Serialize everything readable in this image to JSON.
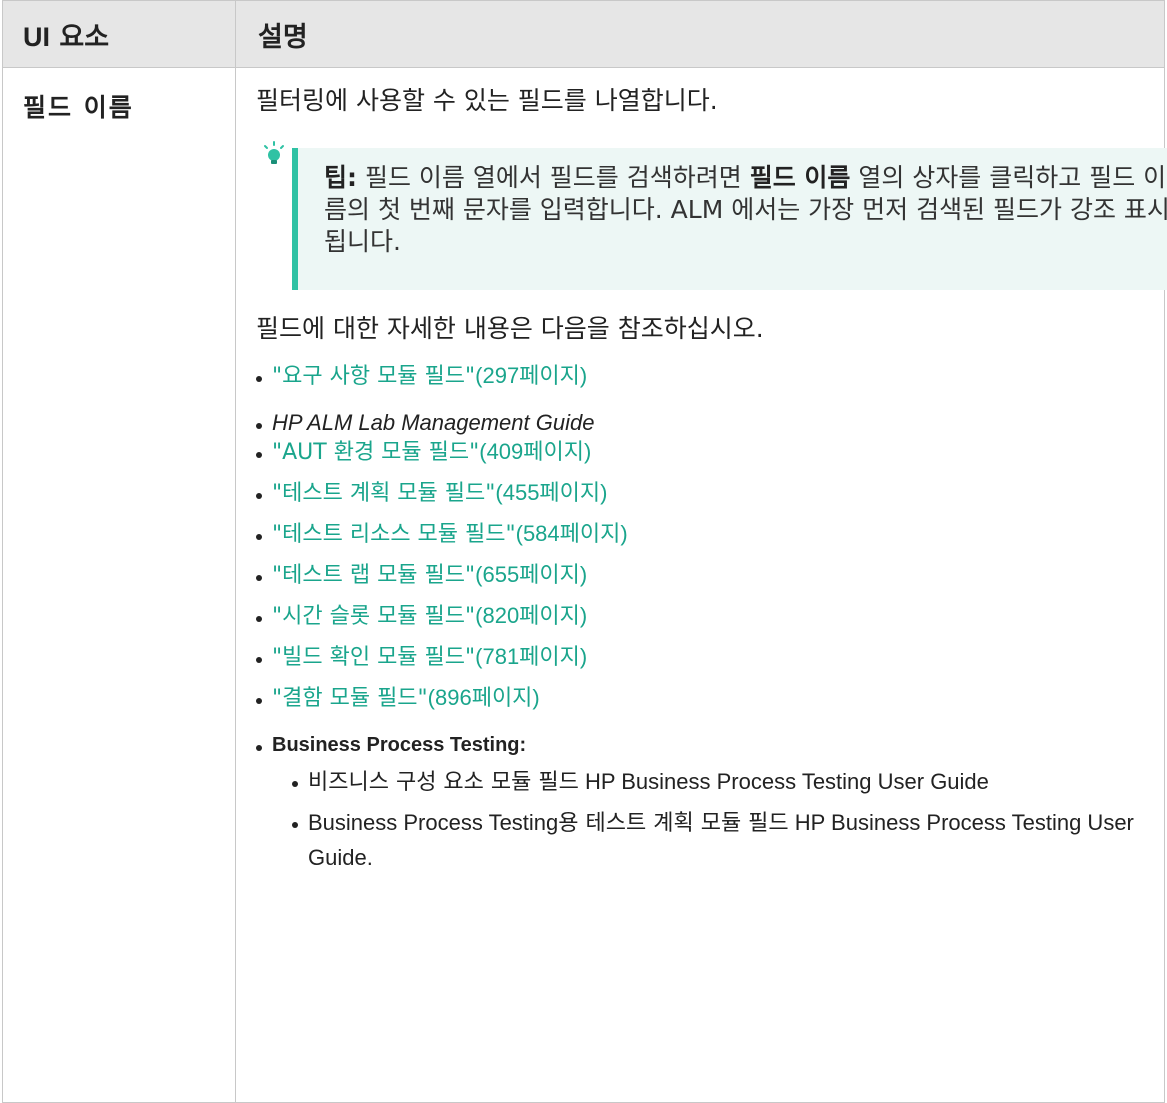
{
  "header": {
    "col1_strong": "UI",
    "col1_rest": " 요소",
    "col2": "설명"
  },
  "row": {
    "name": "필드 이름",
    "intro": "필터링에 사용할 수 있는 필드를 나열합니다.",
    "tip": {
      "label": "팁:",
      "before": " 필드 이름 열에서 필드를 검색하려면 ",
      "bold": "필드 이름",
      "after": " 열의 상자를 클릭하고 필드 이름의 첫 번째 문자를 입력합니다. ALM 에서는 가장 먼저 검색된 필드가 강조 표시됩니다."
    },
    "detail": "필드에 대한 자세한 내용은 다음을 참조하십시오.",
    "links": [
      {
        "title": "\"요구 사항 모듈 필드\"",
        "page": "(297페이지)"
      },
      {
        "italic": "HP ALM Lab Management Guide"
      },
      {
        "title": "\"AUT 환경 모듈 필드\"",
        "page": "(409페이지)"
      },
      {
        "title": "\"테스트 계획 모듈 필드\"",
        "page": "(455페이지)"
      },
      {
        "title": "\"테스트 리소스 모듈 필드\"",
        "page": "(584페이지)"
      },
      {
        "title": "\"테스트 랩 모듈 필드\"",
        "page": "(655페이지)"
      },
      {
        "title": "\"시간 슬롯 모듈 필드\"",
        "page": "(820페이지)"
      },
      {
        "title": "\"빌드 확인 모듈 필드\"",
        "page": "(781페이지)"
      },
      {
        "title": "\"결함 모듈 필드\"",
        "page": "(896페이지)"
      }
    ],
    "bpt": {
      "heading": "Business Process Testing:",
      "items": [
        {
          "ko": "비즈니스 구성 요소 모듈 필드",
          "en": " HP Business Process Testing User Guide"
        },
        {
          "prefix": "Business Process Testing",
          "ko": "용 테스트 계획 모듈 필드",
          "en": " HP Business Process Testing User Guide."
        }
      ]
    }
  }
}
